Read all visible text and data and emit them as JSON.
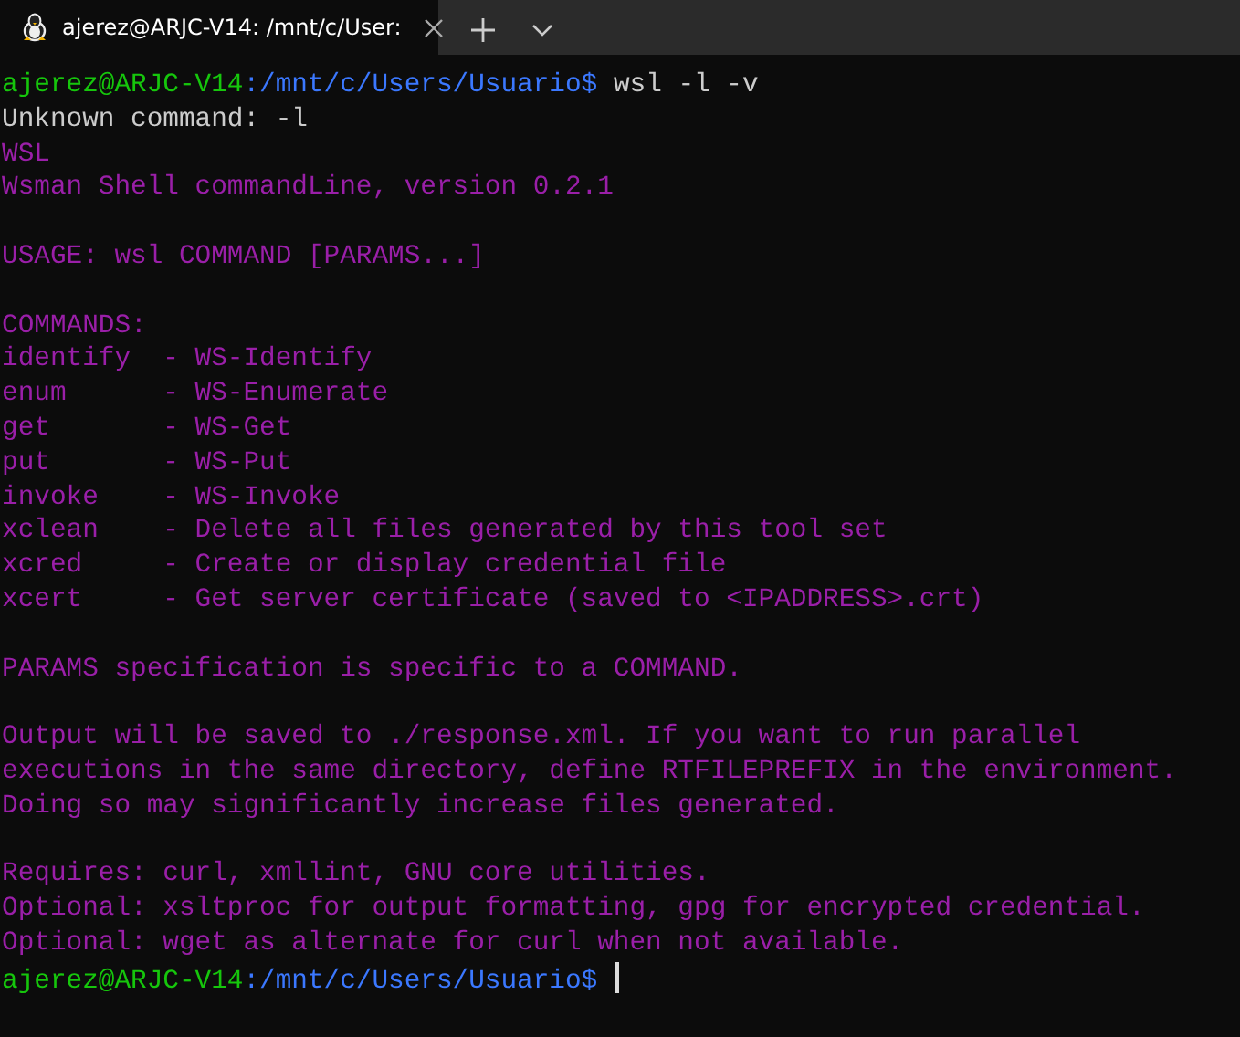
{
  "tabs": [
    {
      "title": "ajerez@ARJC-V14: /mnt/c/User:",
      "selected": true
    }
  ],
  "terminal": {
    "lines": [
      {
        "kind": "prompt",
        "user": "ajerez@ARJC-V14",
        "path": ":/mnt/c/Users/Usuario$",
        "command": "wsl -l -v",
        "cursor": false
      },
      {
        "kind": "output",
        "text": "Unknown command: -l"
      },
      {
        "kind": "message",
        "text": "WSL"
      },
      {
        "kind": "message",
        "text": "Wsman Shell commandLine, version 0.2.1"
      },
      {
        "kind": "blank"
      },
      {
        "kind": "message",
        "text": "USAGE: wsl COMMAND [PARAMS...]"
      },
      {
        "kind": "blank"
      },
      {
        "kind": "message",
        "text": "COMMANDS:"
      },
      {
        "kind": "message",
        "text": "identify  - WS-Identify"
      },
      {
        "kind": "message",
        "text": "enum      - WS-Enumerate"
      },
      {
        "kind": "message",
        "text": "get       - WS-Get"
      },
      {
        "kind": "message",
        "text": "put       - WS-Put"
      },
      {
        "kind": "message",
        "text": "invoke    - WS-Invoke"
      },
      {
        "kind": "message",
        "text": "xclean    - Delete all files generated by this tool set"
      },
      {
        "kind": "message",
        "text": "xcred     - Create or display credential file"
      },
      {
        "kind": "message",
        "text": "xcert     - Get server certificate (saved to <IPADDRESS>.crt)"
      },
      {
        "kind": "blank"
      },
      {
        "kind": "message",
        "text": "PARAMS specification is specific to a COMMAND."
      },
      {
        "kind": "blank"
      },
      {
        "kind": "message",
        "text": "Output will be saved to ./response.xml. If you want to run parallel"
      },
      {
        "kind": "message",
        "text": "executions in the same directory, define RTFILEPREFIX in the environment."
      },
      {
        "kind": "message",
        "text": "Doing so may significantly increase files generated."
      },
      {
        "kind": "blank"
      },
      {
        "kind": "message",
        "text": "Requires: curl, xmllint, GNU core utilities."
      },
      {
        "kind": "message",
        "text": "Optional: xsltproc for output formatting, gpg for encrypted credential."
      },
      {
        "kind": "message",
        "text": "Optional: wget as alternate for curl when not available."
      },
      {
        "kind": "prompt",
        "user": "ajerez@ARJC-V14",
        "path": ":/mnt/c/Users/Usuario$",
        "cursor": true
      }
    ]
  }
}
